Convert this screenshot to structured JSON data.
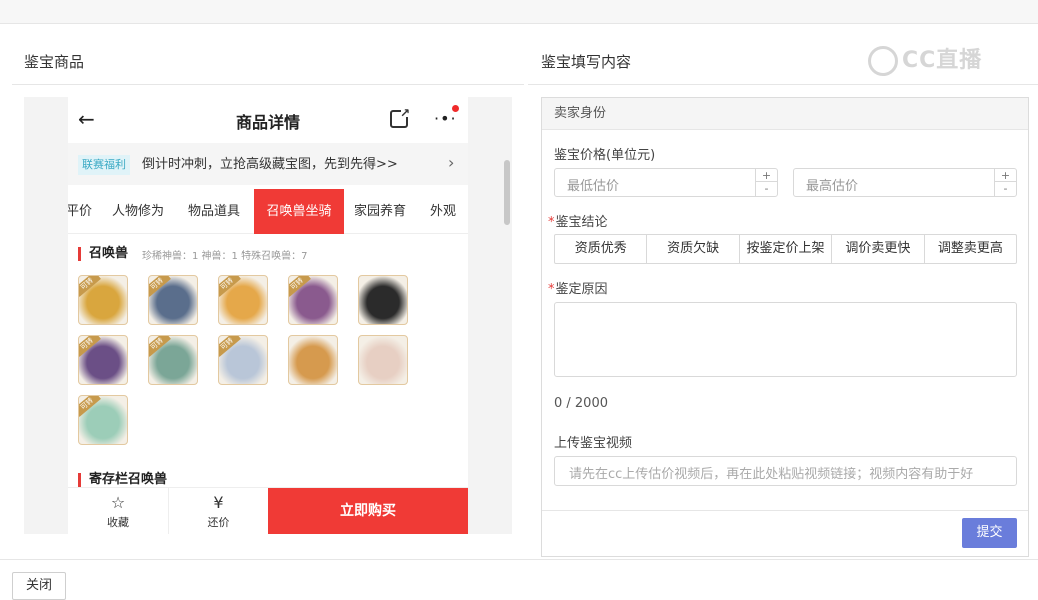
{
  "left_section": {
    "title": "鉴宝商品"
  },
  "right_section": {
    "title": "鉴宝填写内容"
  },
  "watermark": {
    "text": "CC直播"
  },
  "phone": {
    "nav": {
      "title": "商品详情",
      "back_icon": "arrow-left-icon",
      "share_icon": "share-icon",
      "more_icon": "more-icon"
    },
    "promo": {
      "tag": "联赛福利",
      "text": "倒计时冲刺，立抢高级藏宝图，先到先得>>",
      "chevron": "›"
    },
    "tabs": [
      {
        "label": "平价"
      },
      {
        "label": "人物修为"
      },
      {
        "label": "物品道具"
      },
      {
        "label": "召唤兽坐骑"
      },
      {
        "label": "家园养育"
      },
      {
        "label": "外观"
      }
    ],
    "active_tab": "召唤兽坐骑",
    "summon": {
      "heading": "召唤兽",
      "stats": "珍稀神兽：1   神兽：1   特殊召唤兽：7"
    },
    "pet_badge": "可转",
    "pet_colors": [
      "#d9a63e",
      "#5a6e8c",
      "#e5a84a",
      "#8a5a8e",
      "#2b2b2b",
      "#6b4f86",
      "#7ba697",
      "#b9c6d8",
      "#d69a4e",
      "#e7cfc3",
      "#9ccdb8"
    ],
    "storage": {
      "heading": "寄存栏召唤兽"
    },
    "bottom": {
      "favorite": "收藏",
      "favorite_icon": "☆",
      "bargain": "还价",
      "bargain_icon": "¥",
      "buy": "立即购买"
    }
  },
  "form": {
    "panel_title": "卖家身份",
    "price": {
      "label": "鉴宝价格(单位元)",
      "min_placeholder": "最低估价",
      "max_placeholder": "最高估价",
      "plus": "+",
      "minus": "-"
    },
    "conclusion": {
      "label": "鉴宝结论",
      "options": [
        "资质优秀",
        "资质欠缺",
        "按鉴定价上架",
        "调价卖更快",
        "调整卖更高"
      ]
    },
    "reason": {
      "label": "鉴定原因",
      "counter": "0 / 2000"
    },
    "video": {
      "label": "上传鉴宝视频",
      "placeholder": "请先在cc上传估价视频后，再在此处粘贴视频链接；视频内容有助于好"
    },
    "submit": "提交",
    "required_mark": "*"
  },
  "footer": {
    "close": "关闭"
  }
}
